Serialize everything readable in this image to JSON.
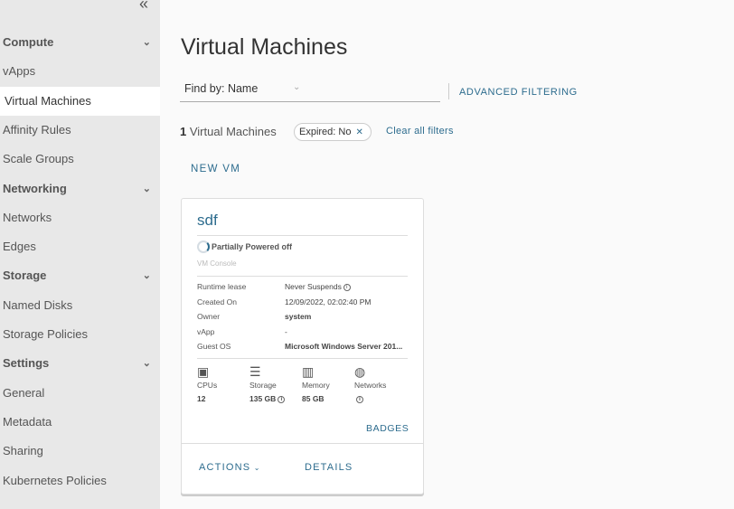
{
  "sidebar": {
    "collapse_icon": "double-chevron-left",
    "items": [
      {
        "label": "Compute",
        "type": "header"
      },
      {
        "label": "vApps"
      },
      {
        "label": "Virtual Machines",
        "active": true
      },
      {
        "label": "Affinity Rules"
      },
      {
        "label": "Scale Groups"
      },
      {
        "label": "Networking",
        "type": "header"
      },
      {
        "label": "Networks"
      },
      {
        "label": "Edges"
      },
      {
        "label": "Storage",
        "type": "header"
      },
      {
        "label": "Named Disks"
      },
      {
        "label": "Storage Policies"
      },
      {
        "label": "Settings",
        "type": "header"
      },
      {
        "label": "General"
      },
      {
        "label": "Metadata"
      },
      {
        "label": "Sharing"
      },
      {
        "label": "Kubernetes Policies"
      }
    ]
  },
  "main": {
    "title": "Virtual Machines",
    "find_by_label": "Find by:",
    "find_by_value": "Name",
    "advanced_filtering": "ADVANCED FILTERING",
    "count": "1",
    "count_label": "Virtual Machines",
    "filter_chip": {
      "key": "Expired:",
      "value": "No"
    },
    "clear_filters": "Clear all filters",
    "new_vm": "NEW VM"
  },
  "card": {
    "name": "sdf",
    "status": "Partially Powered off",
    "console": "VM Console",
    "props": [
      {
        "label": "Runtime lease",
        "value": "Never Suspends",
        "info": true
      },
      {
        "label": "Created On",
        "value": "12/09/2022, 02:02:40 PM"
      },
      {
        "label": "Owner",
        "value": "system",
        "bold": true
      },
      {
        "label": "vApp",
        "value": "-"
      },
      {
        "label": "Guest OS",
        "value": "Microsoft Windows Server 201...",
        "bold": true
      }
    ],
    "resources": [
      {
        "icon": "cpu",
        "label": "CPUs",
        "value": "12"
      },
      {
        "icon": "storage",
        "label": "Storage",
        "value": "135 GB",
        "info": true
      },
      {
        "icon": "memory",
        "label": "Memory",
        "value": "85 GB"
      },
      {
        "icon": "network",
        "label": "Networks",
        "value": "",
        "info": true
      }
    ],
    "badges": "BADGES",
    "actions": "ACTIONS",
    "details": "DETAILS"
  }
}
